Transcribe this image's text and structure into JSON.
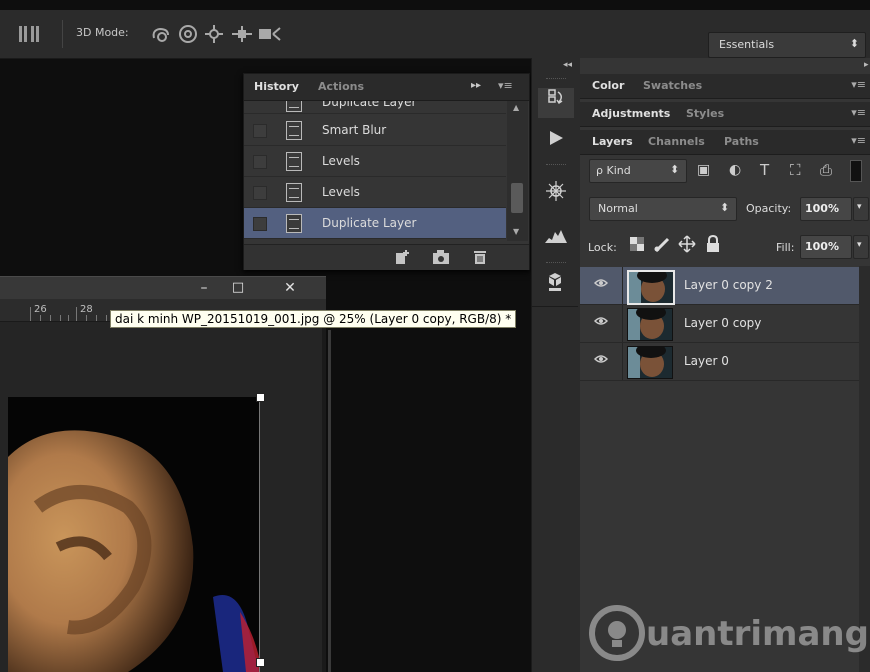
{
  "options_bar": {
    "mode_label": "3D Mode:",
    "icons": [
      "rotate-3d-icon",
      "roll-3d-icon",
      "pan-3d-icon",
      "slide-3d-icon",
      "scale-3d-icon"
    ],
    "workspace": "Essentials",
    "workspace_arrow": "⬍"
  },
  "history_panel": {
    "tabs": [
      "History",
      "Actions"
    ],
    "collapse_glyph": "▸▸",
    "menu_glyph": "▾≡",
    "items": [
      {
        "label": "Duplicate Layer",
        "selected": false
      },
      {
        "label": "Smart Blur",
        "selected": false
      },
      {
        "label": "Levels",
        "selected": false
      },
      {
        "label": "Levels",
        "selected": false
      },
      {
        "label": "Duplicate Layer",
        "selected": true
      }
    ]
  },
  "document": {
    "tooltip": "dai k minh WP_20151019_001.jpg @ 25% (Layer 0 copy, RGB/8) *",
    "ruler_numbers": [
      "26",
      "28"
    ],
    "window_buttons": [
      "–",
      "□",
      "✕"
    ]
  },
  "icon_strip": {
    "collapse_glyph": "◂◂",
    "icons": [
      "history-icon",
      "actions-play-icon",
      "navigator-icon",
      "histogram-icon",
      "3d-icon"
    ]
  },
  "color_panel": {
    "tabs": [
      "Color",
      "Swatches"
    ]
  },
  "adjustments_panel": {
    "tabs": [
      "Adjustments",
      "Styles"
    ]
  },
  "layers_panel": {
    "tabs": [
      "Layers",
      "Channels",
      "Paths"
    ],
    "filter_label": "ρ Kind",
    "filter_icons": [
      "▣",
      "◐",
      "T",
      "⛶",
      "⎙"
    ],
    "blend_mode": "Normal",
    "opacity_label": "Opacity:",
    "opacity_value": "100%",
    "lock_label": "Lock:",
    "fill_label": "Fill:",
    "fill_value": "100%",
    "layers": [
      {
        "name": "Layer 0 copy 2",
        "visible": true,
        "selected": true
      },
      {
        "name": "Layer 0 copy",
        "visible": true,
        "selected": false
      },
      {
        "name": "Layer 0",
        "visible": true,
        "selected": false
      }
    ]
  },
  "watermark": "uantrimang",
  "colors": {
    "selection": "#536080",
    "layer_selection": "#51596b",
    "panel_bg": "#353535",
    "workspace_bg": "#0e0e0e"
  }
}
